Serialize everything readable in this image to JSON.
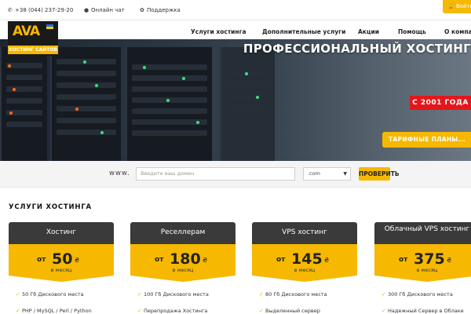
{
  "topbar": {
    "phone": "+38 (044) 237-29-20",
    "chat": "Онлайн чат",
    "support": "Поддержка",
    "login": "Войти"
  },
  "logo": {
    "mark": "AVA",
    "subtitle": "ХОСТИНГ САЙТОВ"
  },
  "nav": {
    "items": [
      "Услуги хостинга",
      "Дополнительные услуги",
      "Акции",
      "Помощь",
      "О компании"
    ]
  },
  "hero": {
    "title": "ПРОФЕССИОНАЛЬНЫЙ ХОСТИНГ",
    "badge": "С 2001 ГОДА",
    "plans_button": "ТАРИФНЫЕ ПЛАНЫ..."
  },
  "domain_search": {
    "prefix": "www.",
    "placeholder": "Введите ваш домен",
    "zone": ".com",
    "button": "ПРОВЕРИТЬ"
  },
  "services": {
    "title": "УСЛУГИ ХОСТИНГА",
    "cards": [
      {
        "name": "Хостинг",
        "from": "от",
        "price": "50",
        "currency": "₴",
        "period": "в месяц",
        "features": [
          "50 Гб Дискового места",
          "PHP / MySQL / Perl / Python"
        ]
      },
      {
        "name": "Реселлерам",
        "from": "от",
        "price": "180",
        "currency": "₴",
        "period": "в месяц",
        "features": [
          "100 Гб Дискового места",
          "Перепродажа Хостинга"
        ]
      },
      {
        "name": "VPS хостинг",
        "from": "от",
        "price": "145",
        "currency": "₴",
        "period": "в месяц",
        "features": [
          "80 Гб Дискового места",
          "Выделенный сервер"
        ]
      },
      {
        "name": "Облачный VPS хостинг",
        "from": "от",
        "price": "375",
        "currency": "₴",
        "period": "в месяц",
        "features": [
          "300 Гб Дискового места",
          "Надежный Сервер в Облаке"
        ]
      }
    ]
  },
  "colors": {
    "accent": "#f6b800",
    "badge_red": "#e3171b",
    "card_header": "#3a3a3a"
  }
}
